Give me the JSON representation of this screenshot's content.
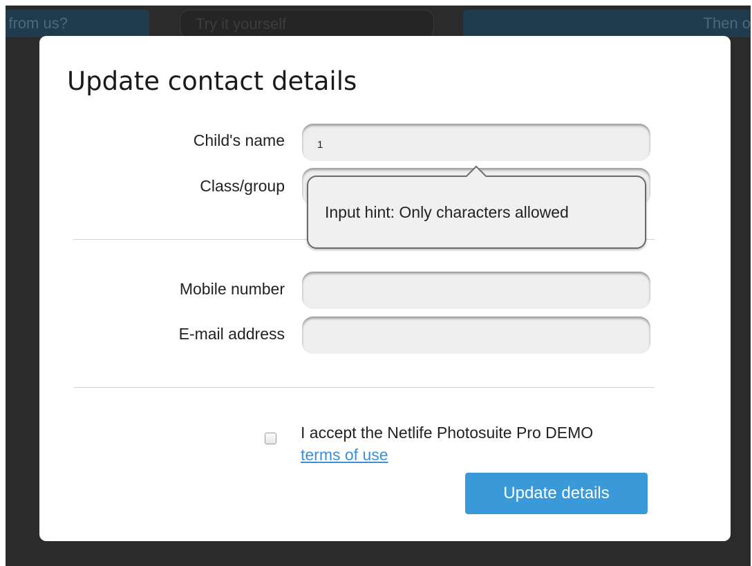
{
  "background": {
    "tab_left": "e from us?",
    "tab_middle": "Try it yourself",
    "tab_right": "Then o"
  },
  "modal": {
    "title": "Update contact details",
    "fields": [
      {
        "label": "Child's name",
        "value": "1",
        "placeholder": ""
      },
      {
        "label": "Class/group",
        "value": "",
        "placeholder": ""
      },
      {
        "label": "Mobile number",
        "value": "",
        "placeholder": ""
      },
      {
        "label": "E-mail address",
        "value": "",
        "placeholder": ""
      }
    ],
    "tooltip": "Input hint: Only characters allowed",
    "terms": {
      "checked": false,
      "text_before": "I accept the Netlife Photosuite Pro DEMO ",
      "link_text": "terms of use"
    },
    "submit_label": "Update details"
  },
  "colors": {
    "accent": "#3a9ad9",
    "link": "#3b8fd6",
    "overlay": "#2b2b2b"
  }
}
